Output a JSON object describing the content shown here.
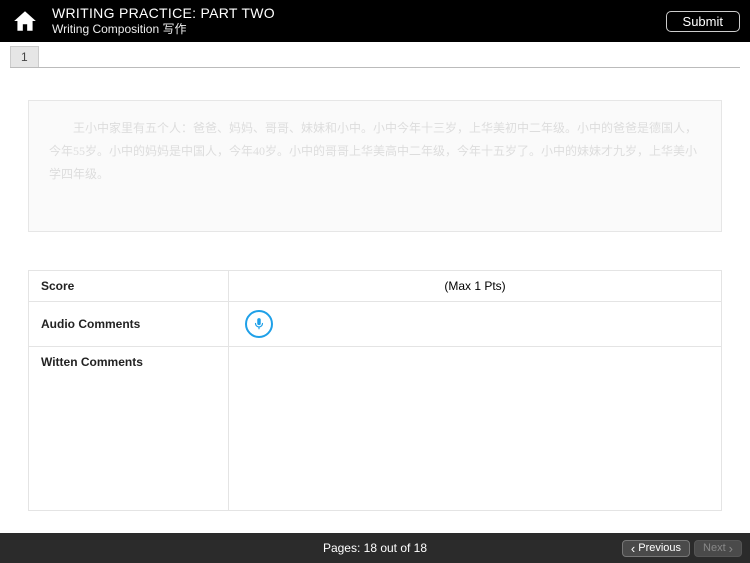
{
  "header": {
    "title": "WRITING PRACTICE: PART TWO",
    "subtitle": "Writing Composition 写作",
    "submit_label": "Submit"
  },
  "tabs": [
    "1"
  ],
  "essay_text": "王小中家里有五个人：爸爸、妈妈、哥哥、妹妹和小中。小中今年十三岁，上华美初中二年级。小中的爸爸是德国人，今年55岁。小中的妈妈是中国人，今年40岁。小中的哥哥上华美高中二年级，今年十五岁了。小中的妹妹才九岁，上华美小学四年级。",
  "feedback": {
    "score_label": "Score",
    "score_hint": "(Max 1 Pts)",
    "audio_label": "Audio Comments",
    "written_label": "Witten Comments"
  },
  "footer": {
    "pages_text": "Pages: 18 out of 18",
    "prev_label": "Previous",
    "next_label": "Next"
  }
}
